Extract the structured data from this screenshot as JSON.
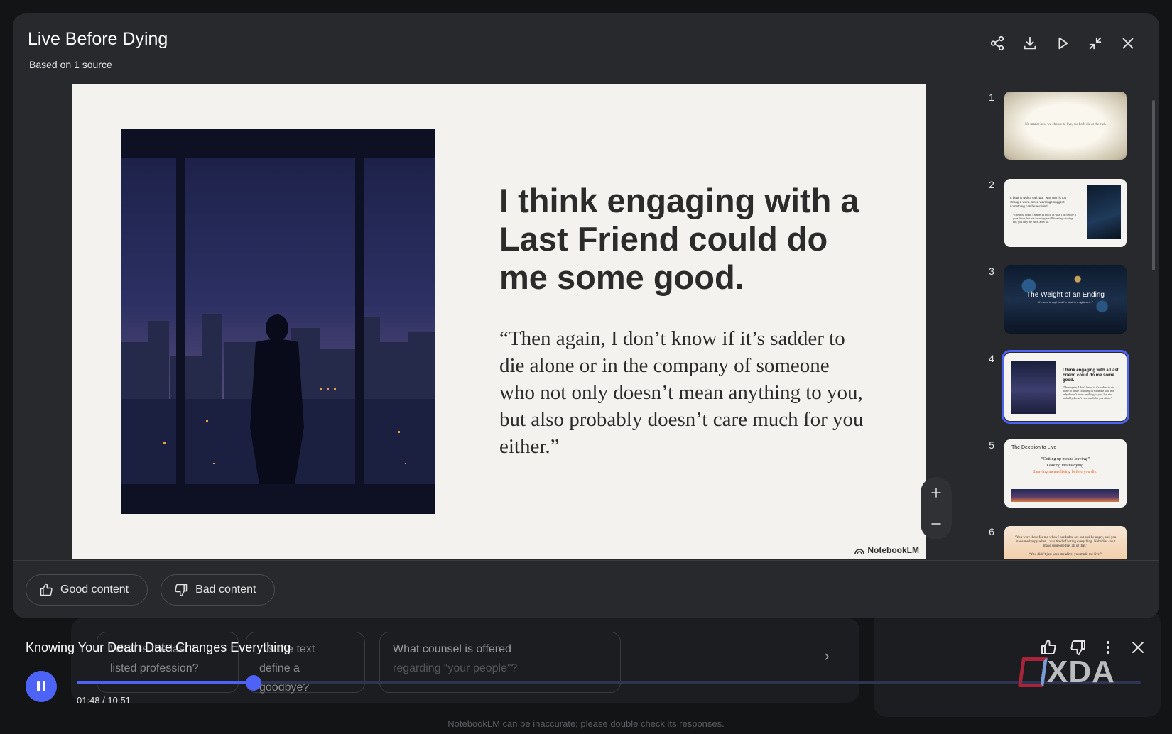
{
  "modal": {
    "title": "Live Before Dying",
    "subtitle": "Based on 1 source",
    "actions": [
      "share-icon",
      "download-icon",
      "play-icon",
      "collapse-icon",
      "close-icon"
    ]
  },
  "slide": {
    "heading": "I think engaging with a Last Friend could do me some good.",
    "quote": "“Then again, I don’t know if it’s sadder to die alone or in the company of someone who not only doesn’t mean anything to you, but also probably doesn’t care much for you either.”",
    "brand": "NotebookLM"
  },
  "thumbnails": [
    {
      "number": "1",
      "text": "No matter how we choose to live, we both die at the end."
    },
    {
      "number": "2",
      "text": "It begins with a call. But “warning” is too strong a word, since warnings suggest something can be avoided.",
      "quote": "“The how doesn’t matter as much as what I do before it goes down, but not knowing is still freaking choking me; you only die once, after all.”"
    },
    {
      "number": "3",
      "title": "The Weight of an Ending",
      "text": "“It’s weird to say I think I’m stuck in a nightmare…”"
    },
    {
      "number": "4",
      "title": "I think engaging with a Last Friend could do me some good.",
      "text": "“Then again, I don’t know if it’s sadder to die alone or in the company of someone who not only doesn’t mean anything to you, but also probably doesn’t care much for you either.”",
      "selected": true
    },
    {
      "number": "5",
      "title": "The Decision to Live",
      "line1": "“Getting up means leaving.”",
      "line2": "Leaving means dying.",
      "line3": "Leaving means living before you die."
    },
    {
      "number": "6",
      "text": "“You were there for me when I needed to act out and be angry, and you made me happy when I was tired of hating everything. Nobodies can’t make someone feel all of that.”",
      "text2": "“You didn’t just keep me alive, you made me live.”"
    }
  ],
  "feedback": {
    "good_label": "Good content",
    "bad_label": "Bad content"
  },
  "player": {
    "title": "Knowing Your Death Date Changes Everything",
    "time": "01:48 / 10:51",
    "progress_fraction": 0.166
  },
  "background": {
    "chip1": "What is the last ... listed profession?",
    "chip1_a": "What is the last",
    "chip1_b": "listed profession?",
    "chip2_a": "...s the text",
    "chip2_b": "define a goodbye?",
    "chip3_a": "What counsel is offered",
    "chip3_b": "regarding “your people”?",
    "disclaimer": "NotebookLM can be inaccurate; please double check its responses."
  },
  "watermark": "XDA",
  "colors": {
    "accent": "#4d62f7",
    "modal_bg": "#27292d",
    "page_bg": "#131416",
    "slide_bg": "#f4f2ee"
  }
}
